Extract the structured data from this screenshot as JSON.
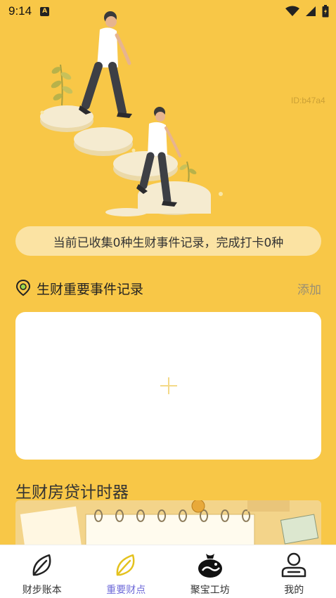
{
  "status_bar": {
    "time": "9:14",
    "notification_icon_letter": "A"
  },
  "watermark": "ID:b47a4",
  "summary": {
    "text": "当前已收集0种生财事件记录，完成打卡0种"
  },
  "events_section": {
    "title": "生财重要事件记录",
    "add_label": "添加"
  },
  "mortgage_section": {
    "title": "生财房贷计时器"
  },
  "tabs": [
    {
      "label": "财步账本",
      "icon": "leaf-outline-icon",
      "active": false
    },
    {
      "label": "重要财点",
      "icon": "leaf-yellow-icon",
      "active": true
    },
    {
      "label": "聚宝工坊",
      "icon": "money-bag-icon",
      "active": false
    },
    {
      "label": "我的",
      "icon": "user-icon",
      "active": false
    }
  ],
  "colors": {
    "background": "#F8C747",
    "active_tab": "#6E6AD8",
    "pill": "#FBE3A3"
  }
}
